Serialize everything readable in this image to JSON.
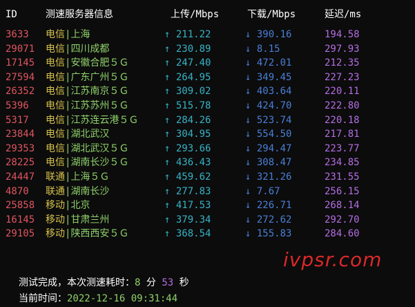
{
  "header": {
    "id": "ID",
    "server": "测速服务器信息",
    "upload": "上传/Mbps",
    "download": "下载/Mbps",
    "latency": "延迟/ms"
  },
  "icons": {
    "up_arrow": "↑",
    "down_arrow": "↓"
  },
  "rows": [
    {
      "id": "3633",
      "isp": "电信",
      "location": "上海",
      "upload": "211.22",
      "download": "390.16",
      "latency": "194.58"
    },
    {
      "id": "29071",
      "isp": "电信",
      "location": "四川成都",
      "upload": "230.89",
      "download": "8.15",
      "latency": "297.93"
    },
    {
      "id": "17145",
      "isp": "电信",
      "location": "安徽合肥５Ｇ",
      "upload": "247.40",
      "download": "472.01",
      "latency": "212.35"
    },
    {
      "id": "27594",
      "isp": "电信",
      "location": "广东广州５Ｇ",
      "upload": "264.95",
      "download": "349.45",
      "latency": "227.23"
    },
    {
      "id": "26352",
      "isp": "电信",
      "location": "江苏南京５Ｇ",
      "upload": "309.02",
      "download": "403.64",
      "latency": "220.11"
    },
    {
      "id": "5396",
      "isp": "电信",
      "location": "江苏苏州５Ｇ",
      "upload": "515.78",
      "download": "424.70",
      "latency": "222.80"
    },
    {
      "id": "5317",
      "isp": "电信",
      "location": "江苏连云港５Ｇ",
      "upload": "284.26",
      "download": "523.74",
      "latency": "220.18"
    },
    {
      "id": "23844",
      "isp": "电信",
      "location": "湖北武汉",
      "upload": "304.95",
      "download": "554.50",
      "latency": "217.81"
    },
    {
      "id": "29353",
      "isp": "电信",
      "location": "湖北武汉５Ｇ",
      "upload": "293.66",
      "download": "294.47",
      "latency": "223.77"
    },
    {
      "id": "28225",
      "isp": "电信",
      "location": "湖南长沙５Ｇ",
      "upload": "436.43",
      "download": "308.47",
      "latency": "234.85"
    },
    {
      "id": "24447",
      "isp": "联通",
      "location": "上海５Ｇ",
      "upload": "459.62",
      "download": "321.26",
      "latency": "231.55"
    },
    {
      "id": "4870",
      "isp": "联通",
      "location": "湖南长沙",
      "upload": "277.83",
      "download": "7.67",
      "latency": "256.15"
    },
    {
      "id": "25858",
      "isp": "移动",
      "location": "北京",
      "upload": "417.53",
      "download": "226.71",
      "latency": "268.14"
    },
    {
      "id": "16145",
      "isp": "移动",
      "location": "甘肃兰州",
      "upload": "379.34",
      "download": "272.62",
      "latency": "292.70"
    },
    {
      "id": "29105",
      "isp": "移动",
      "location": "陕西西安５Ｇ",
      "upload": "368.54",
      "download": "155.83",
      "latency": "284.60"
    }
  ],
  "footer": {
    "done_label": "测试完成，本次测速耗时：",
    "minutes": "8",
    "min_unit": "分",
    "seconds": "53",
    "sec_unit": "秒",
    "time_label": "当前时间：",
    "time_value": "2022-12-16 09:31:44"
  },
  "watermark": "ivpsr.com"
}
